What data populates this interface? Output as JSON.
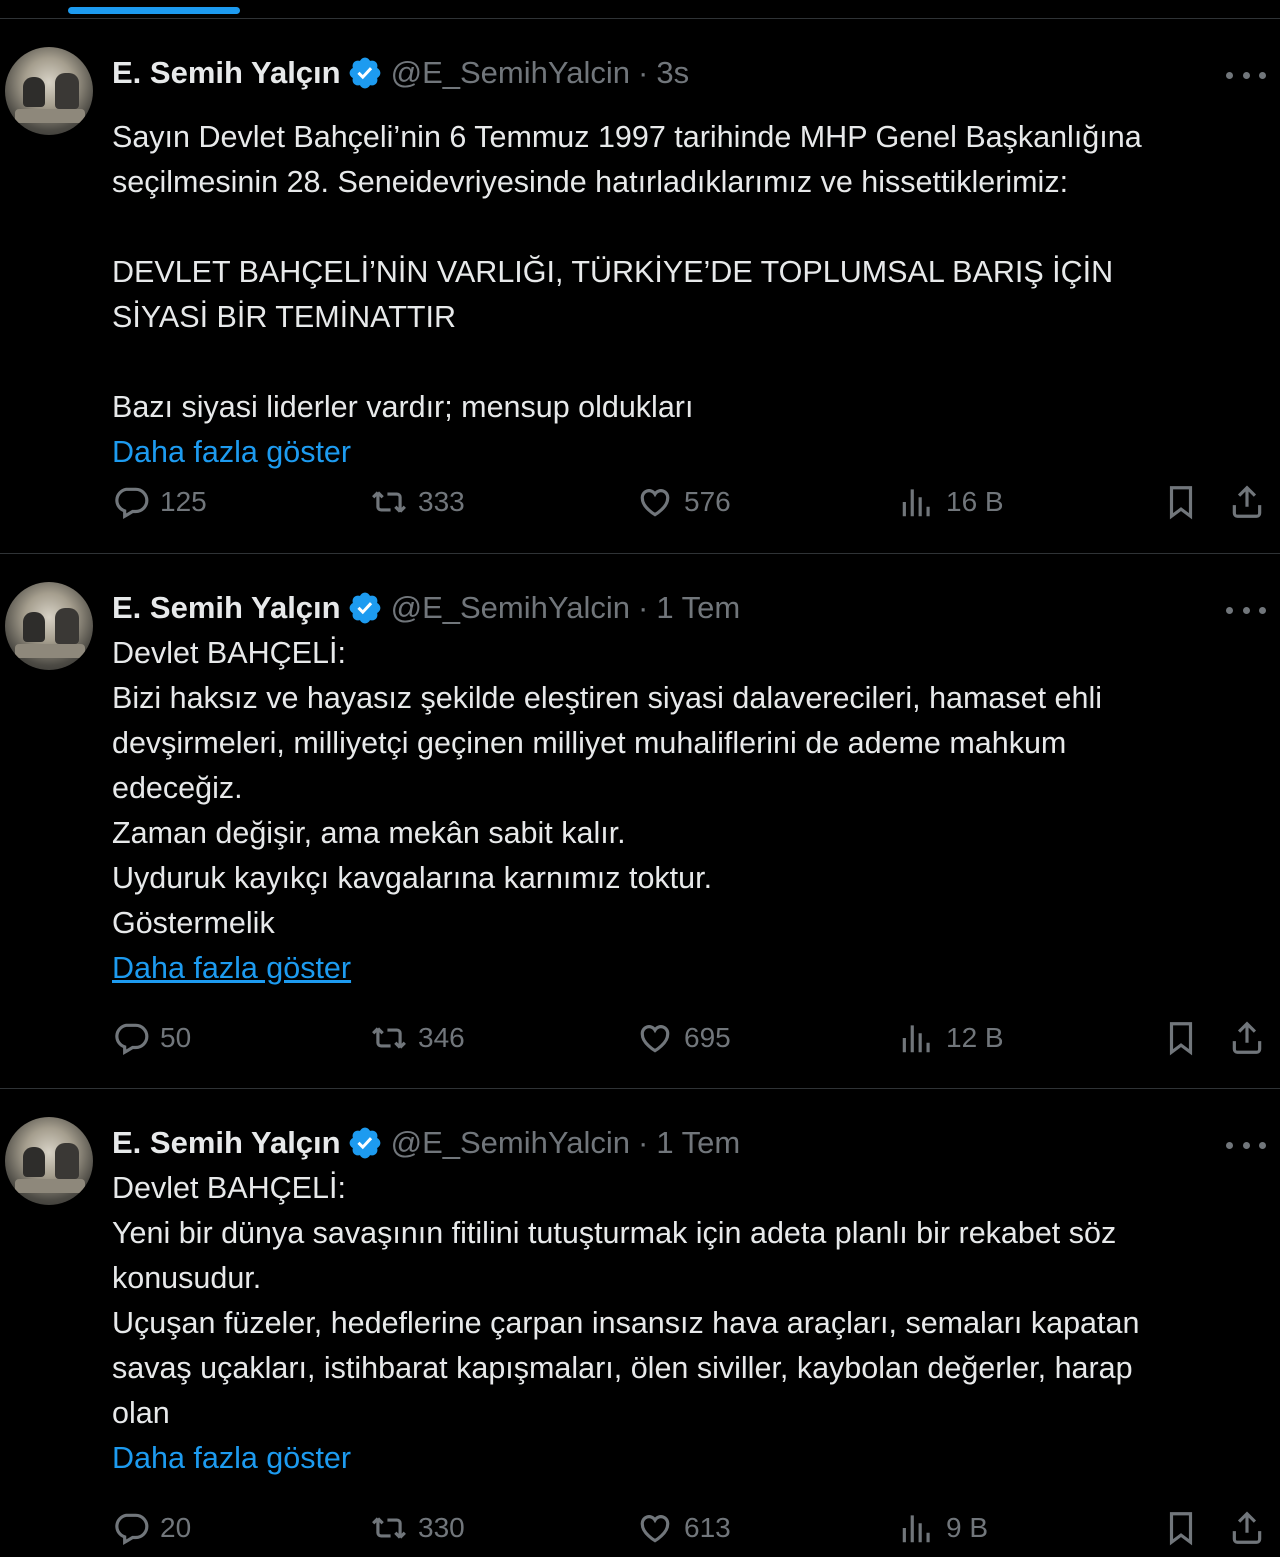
{
  "tweets": [
    {
      "name": "E. Semih Yalçın",
      "handle": "@E_SemihYalcin",
      "dot": "·",
      "time": "3s",
      "paragraphs": [
        "Sayın Devlet Bahçeli’nin 6 Temmuz 1997 tarihinde MHP Genel Başkanlığına\nseçilmesinin 28. Seneidevriyesinde hatırladıklarımız ve hissettiklerimiz:",
        "DEVLET BAHÇELİ’NİN VARLIĞI, TÜRKİYE’DE TOPLUMSAL BARIŞ İÇİN\nSİYASİ BİR TEMİNATTIR",
        "Bazı siyasi liderler vardır; mensup oldukları"
      ],
      "show_more": "Daha fazla göster",
      "replies": "125",
      "retweets": "333",
      "likes": "576",
      "views": "16 B"
    },
    {
      "name": "E. Semih Yalçın",
      "handle": "@E_SemihYalcin",
      "dot": "·",
      "time": "1 Tem",
      "paragraphs": [
        "Devlet BAHÇELİ:\nBizi haksız ve hayasız şekilde eleştiren siyasi dalaverecileri, hamaset ehli\ndevşirmeleri, milliyetçi geçinen milliyet muhaliflerini de ademe mahkum\nedeceğiz.\nZaman değişir, ama mekân sabit kalır.\nUyduruk kayıkçı kavgalarına karnımız toktur.\nGöstermelik"
      ],
      "show_more": "Daha fazla göster",
      "replies": "50",
      "retweets": "346",
      "likes": "695",
      "views": "12 B"
    },
    {
      "name": "E. Semih Yalçın",
      "handle": "@E_SemihYalcin",
      "dot": "·",
      "time": "1 Tem",
      "paragraphs": [
        "Devlet BAHÇELİ:\nYeni bir dünya savaşının fitilini tutuşturmak için adeta planlı bir rekabet söz\nkonusudur.\nUçuşan füzeler, hedeflerine çarpan insansız hava araçları, semaları kapatan\nsavaş uçakları, istihbarat kapışmaları, ölen siviller, kaybolan değerler, harap\nolan"
      ],
      "show_more": "Daha fazla göster",
      "replies": "20",
      "retweets": "330",
      "likes": "613",
      "views": "9 B"
    }
  ],
  "colors": {
    "accent": "#1d9bf0",
    "muted": "#71767b",
    "text": "#e7e9ea",
    "border": "#2f3336"
  },
  "icons": [
    "verified-badge-icon",
    "more-icon",
    "reply-icon",
    "retweet-icon",
    "like-icon",
    "views-icon",
    "bookmark-icon",
    "share-icon"
  ]
}
